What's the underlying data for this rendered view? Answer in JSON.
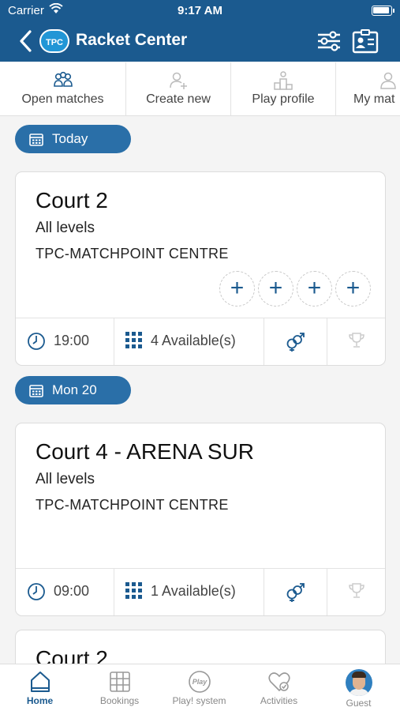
{
  "status": {
    "carrier": "Carrier",
    "time": "9:17 AM"
  },
  "header": {
    "logo": "TPC",
    "title": "Racket Center"
  },
  "tabs": [
    {
      "label": "Open matches",
      "icon": "group-icon"
    },
    {
      "label": "Create new",
      "icon": "add-person-icon"
    },
    {
      "label": "Play profile",
      "icon": "podium-icon"
    },
    {
      "label": "My mat",
      "icon": "person-icon"
    }
  ],
  "days": [
    {
      "label": "Today",
      "match": {
        "court": "Court 2",
        "levels": "All levels",
        "club": "TPC-MATCHPOINT CENTRE",
        "time": "19:00",
        "available": "4 Available(s)",
        "slots": [
          "+",
          "+",
          "+",
          "+"
        ]
      }
    },
    {
      "label": "Mon 20",
      "match": {
        "court": "Court 4 - ARENA SUR",
        "levels": "All levels",
        "club": "TPC-MATCHPOINT CENTRE",
        "time": "09:00",
        "available": "1 Available(s)"
      }
    }
  ],
  "partial_card": {
    "court": "Court 2"
  },
  "bottom_nav": [
    {
      "label": "Home",
      "icon": "home-icon",
      "active": true
    },
    {
      "label": "Bookings",
      "icon": "bookings-icon"
    },
    {
      "label": "Play! system",
      "icon": "play-system-icon"
    },
    {
      "label": "Activities",
      "icon": "heart-check-icon"
    },
    {
      "label": "Guest",
      "icon": "avatar"
    }
  ],
  "colors": {
    "primary": "#1b5a8f",
    "pill": "#2a6fa8",
    "background": "#f4f4f4"
  }
}
